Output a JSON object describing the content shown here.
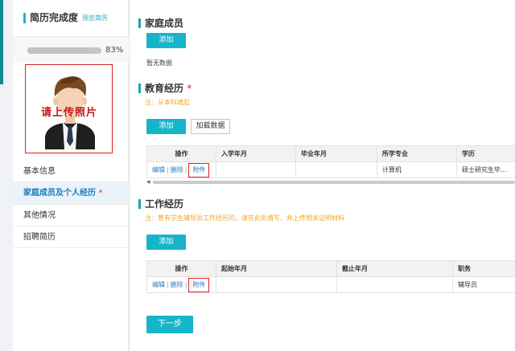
{
  "sidebar": {
    "title": "简历完成度",
    "preview_link": "预览简历",
    "progress": {
      "percent_label": "83%",
      "value": 0.83
    },
    "photo_text": "请上传照片",
    "menu": [
      {
        "label": "基本信息",
        "active": false,
        "required": false
      },
      {
        "label": "家庭成员及个人经历",
        "active": true,
        "required": true
      },
      {
        "label": "其他情况",
        "active": false,
        "required": false
      },
      {
        "label": "招聘简历",
        "active": false,
        "required": false
      }
    ],
    "required_mark": "*"
  },
  "family": {
    "title": "家庭成员",
    "add_label": "添加",
    "empty_text": "暂无数据"
  },
  "education": {
    "title": "教育经历",
    "required_mark": "*",
    "note": "注：从本科填起",
    "add_label": "添加",
    "load_label": "加载数据",
    "columns": [
      "操作",
      "入学年月",
      "毕业年月",
      "所学专业",
      "学历"
    ],
    "rows": [
      {
        "edit": "编辑",
        "delete": "删除",
        "attach": "附件",
        "start": "",
        "end": "",
        "major": "计算机",
        "degree": "硕士研究生毕..."
      }
    ]
  },
  "work": {
    "title": "工作经历",
    "note": "注：曾有学生辅导员工作经历的，请在此处填写，并上传相关证明材料",
    "add_label": "添加",
    "columns": [
      "操作",
      "起始年月",
      "截止年月",
      "职务"
    ],
    "rows": [
      {
        "edit": "编辑",
        "delete": "删除",
        "attach": "附件",
        "start": "",
        "end": "",
        "position": "辅导员"
      }
    ]
  },
  "separator": "|",
  "next_label": "下一步",
  "colors": {
    "accent": "#17b5c9",
    "link": "#2a7cc7",
    "required": "#e02020",
    "note": "#f0a52a"
  }
}
